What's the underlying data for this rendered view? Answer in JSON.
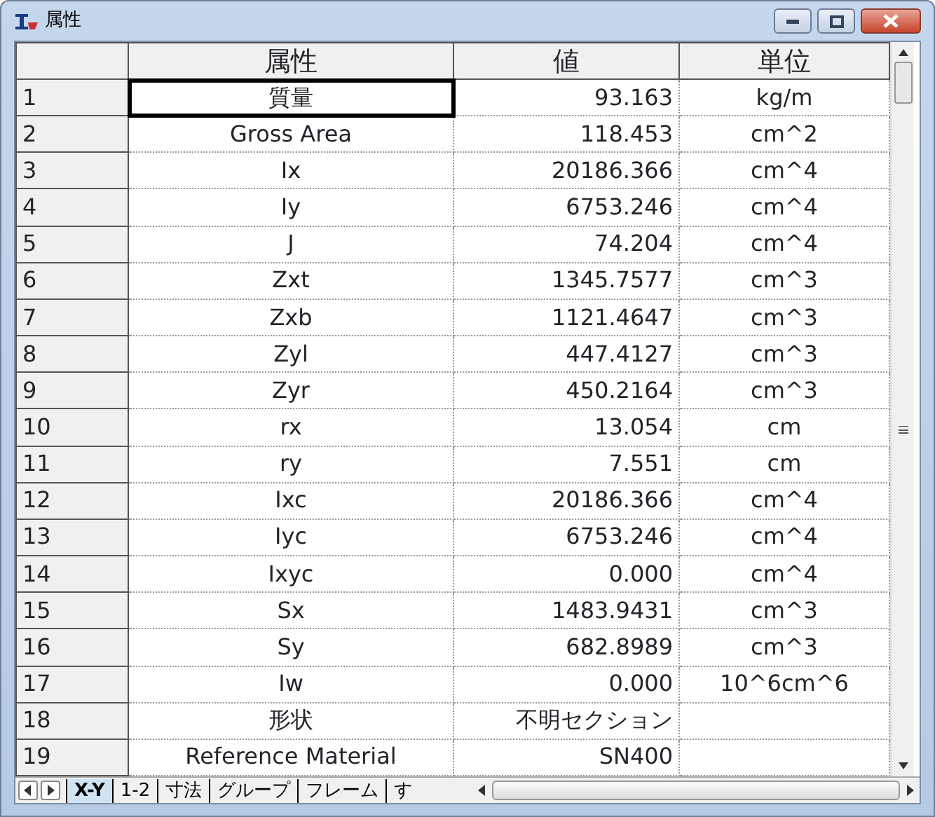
{
  "window": {
    "title": "属性"
  },
  "table": {
    "columns": [
      "属性",
      "値",
      "単位"
    ],
    "rows": [
      {
        "number": "1",
        "property": "質量",
        "value": "93.163",
        "unit": "kg/m",
        "selected": true
      },
      {
        "number": "2",
        "property": "Gross Area",
        "value": "118.453",
        "unit": "cm^2",
        "selected": false
      },
      {
        "number": "3",
        "property": "Ix",
        "value": "20186.366",
        "unit": "cm^4",
        "selected": false
      },
      {
        "number": "4",
        "property": "Iy",
        "value": "6753.246",
        "unit": "cm^4",
        "selected": false
      },
      {
        "number": "5",
        "property": "J",
        "value": "74.204",
        "unit": "cm^4",
        "selected": false
      },
      {
        "number": "6",
        "property": "Zxt",
        "value": "1345.7577",
        "unit": "cm^3",
        "selected": false
      },
      {
        "number": "7",
        "property": "Zxb",
        "value": "1121.4647",
        "unit": "cm^3",
        "selected": false
      },
      {
        "number": "8",
        "property": "Zyl",
        "value": "447.4127",
        "unit": "cm^3",
        "selected": false
      },
      {
        "number": "9",
        "property": "Zyr",
        "value": "450.2164",
        "unit": "cm^3",
        "selected": false
      },
      {
        "number": "10",
        "property": "rx",
        "value": "13.054",
        "unit": "cm",
        "selected": false
      },
      {
        "number": "11",
        "property": "ry",
        "value": "7.551",
        "unit": "cm",
        "selected": false
      },
      {
        "number": "12",
        "property": "Ixc",
        "value": "20186.366",
        "unit": "cm^4",
        "selected": false
      },
      {
        "number": "13",
        "property": "Iyc",
        "value": "6753.246",
        "unit": "cm^4",
        "selected": false
      },
      {
        "number": "14",
        "property": "Ixyc",
        "value": "0.000",
        "unit": "cm^4",
        "selected": false
      },
      {
        "number": "15",
        "property": "Sx",
        "value": "1483.9431",
        "unit": "cm^3",
        "selected": false
      },
      {
        "number": "16",
        "property": "Sy",
        "value": "682.8989",
        "unit": "cm^3",
        "selected": false
      },
      {
        "number": "17",
        "property": "Iw",
        "value": "0.000",
        "unit": "10^6cm^6",
        "selected": false
      },
      {
        "number": "18",
        "property": "形状",
        "value": "不明セクション",
        "selected": false
      },
      {
        "number": "19",
        "property": "Reference Material",
        "value": "SN400",
        "selected": false
      }
    ]
  },
  "sheet_tabs": [
    {
      "label": "X-Y",
      "selected": true
    },
    {
      "label": "1-2",
      "selected": false
    },
    {
      "label": "寸法",
      "selected": false
    },
    {
      "label": "グループ",
      "selected": false
    },
    {
      "label": "フレーム",
      "selected": false
    },
    {
      "label": "す",
      "selected": false
    }
  ]
}
